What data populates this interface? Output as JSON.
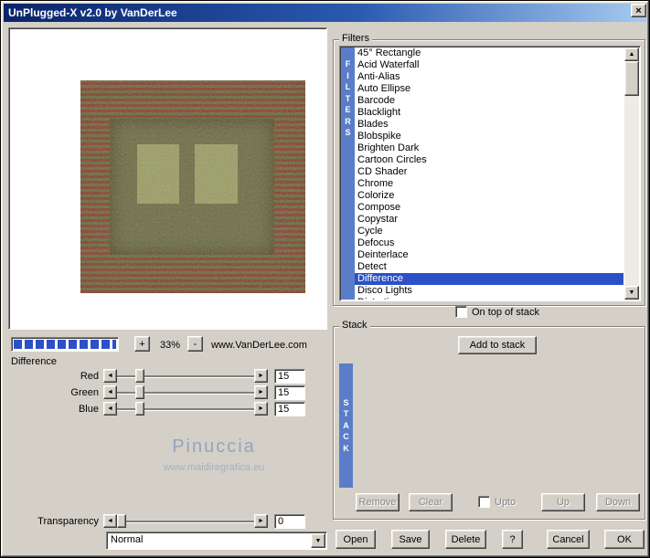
{
  "window": {
    "title": "UnPlugged-X v2.0 by VanDerLee"
  },
  "icons": {
    "close": "×",
    "left": "◄",
    "right": "►",
    "up": "▲",
    "down": "▼"
  },
  "preview": {
    "zoom_in": "+",
    "zoom_out": "-",
    "zoom_level": "33%",
    "website": "www.VanDerLee.com"
  },
  "filter_controls": {
    "filter_name": "Difference",
    "sliders": [
      {
        "label": "Red",
        "value": "15"
      },
      {
        "label": "Green",
        "value": "15"
      },
      {
        "label": "Blue",
        "value": "15"
      }
    ],
    "transparency": {
      "label": "Transparency",
      "value": "0"
    },
    "blend_mode": "Normal",
    "watermark": {
      "line1": "Pinuccia",
      "line2": "www.maidiregrafica.eu"
    }
  },
  "filters_panel": {
    "title": "Filters",
    "vertical_label": "F\nI\nL\nT\nE\nR\nS",
    "selected": "Difference",
    "items": [
      "45° Rectangle",
      "Acid Waterfall",
      "Anti-Alias",
      "Auto Ellipse",
      "Barcode",
      "Blacklight",
      "Blades",
      "Blobspike",
      "Brighten Dark",
      "Cartoon Circles",
      "CD Shader",
      "Chrome",
      "Colorize",
      "Compose",
      "Copystar",
      "Cycle",
      "Defocus",
      "Deinterlace",
      "Detect",
      "Difference",
      "Disco Lights",
      "Distortion"
    ],
    "on_top_label": "On top of stack"
  },
  "stack_panel": {
    "title": "Stack",
    "add_button": "Add to stack",
    "vertical_label": "S\nT\nA\nC\nK",
    "remove_button": "Remove",
    "clear_button": "Clear",
    "upto_label": "Upto",
    "up_button": "Up",
    "down_button": "Down"
  },
  "action_buttons": {
    "open": "Open",
    "save": "Save",
    "delete": "Delete",
    "help": "?",
    "cancel": "Cancel",
    "ok": "OK"
  },
  "colors": {
    "titlebar_left": "#0a246a",
    "titlebar_right": "#a6caf0",
    "dialog_bg": "#d4d0c8",
    "selection_bg": "#2b50c8",
    "strip_bg": "#5b7cc8"
  }
}
